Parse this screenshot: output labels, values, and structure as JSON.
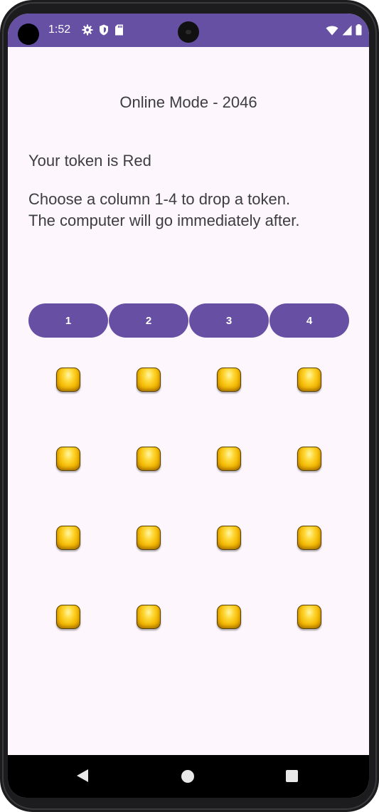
{
  "status_bar": {
    "time": "1:52",
    "icons_left": [
      "gear-icon",
      "shield-icon",
      "sd-card-icon"
    ],
    "icons_right": [
      "wifi-icon",
      "signal-icon",
      "battery-icon"
    ],
    "color": "#6650a4"
  },
  "game": {
    "title": "Online Mode - 2046",
    "token_text": "Your token is Red",
    "instruction_line1": "Choose a column 1-4 to drop a token.",
    "instruction_line2": "The computer will go immediately after."
  },
  "columns": [
    {
      "label": "1"
    },
    {
      "label": "2"
    },
    {
      "label": "3"
    },
    {
      "label": "4"
    }
  ],
  "board": {
    "rows": 4,
    "cols": 4,
    "cell_icon": "yellow-token-icon"
  },
  "nav_bar": {
    "icons": [
      "back-icon",
      "home-icon",
      "recent-apps-icon"
    ]
  },
  "colors": {
    "accent": "#6750a4",
    "background": "#fdf7fd",
    "text": "#3d3d3f",
    "token": "#f2b700"
  }
}
